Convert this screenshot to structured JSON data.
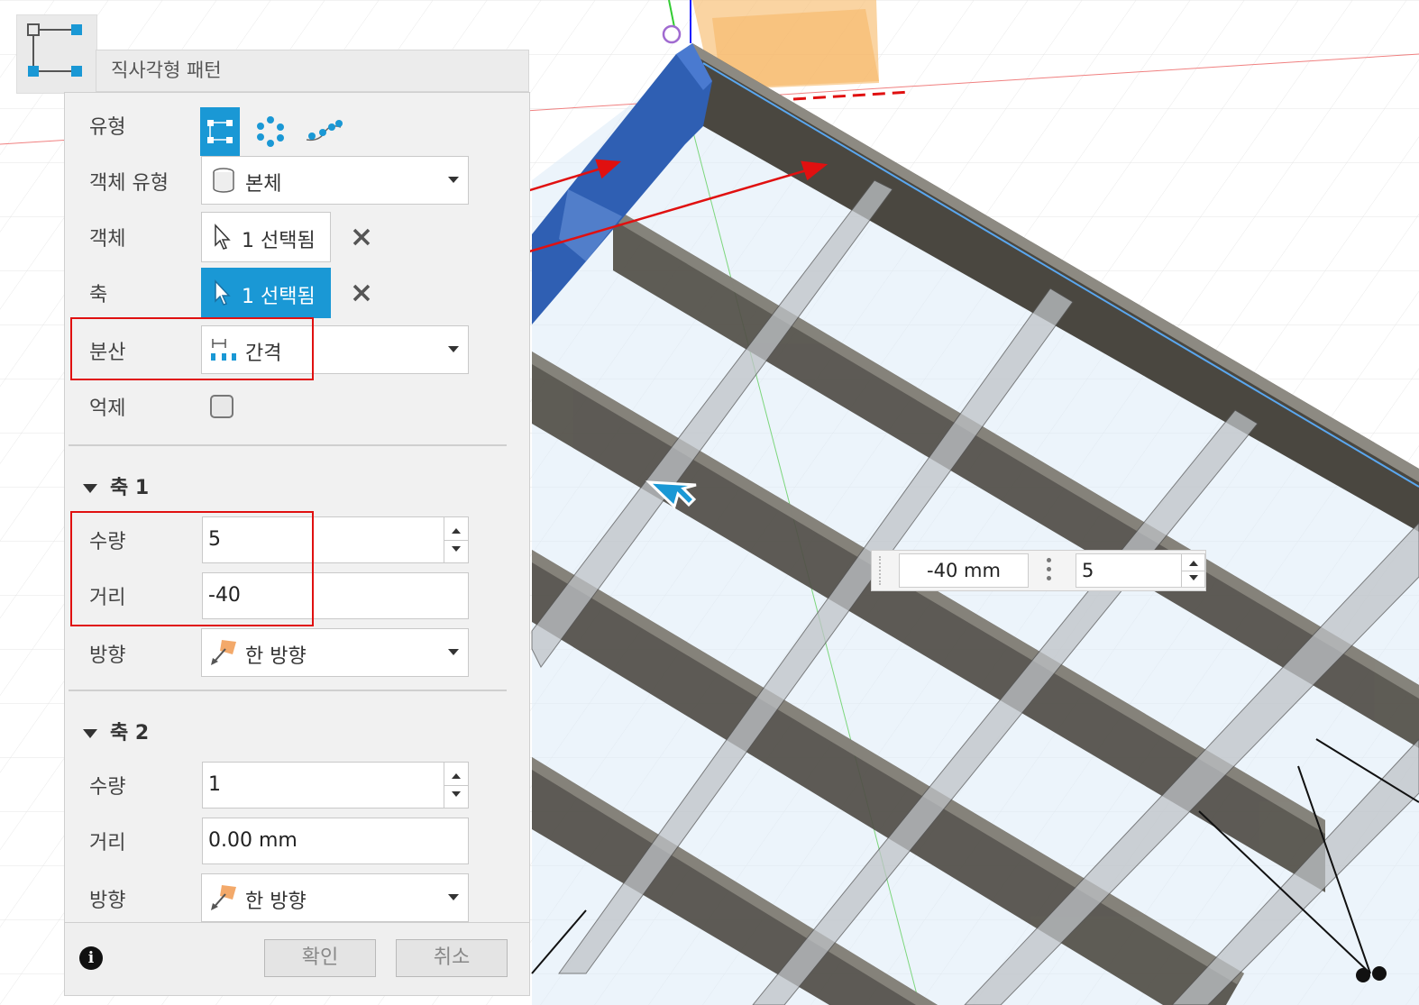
{
  "dialog": {
    "title": "직사각형 패턴",
    "rows": {
      "type_label": "유형",
      "object_type_label": "객체 유형",
      "object_type_value": "본체",
      "objects_label": "객체",
      "objects_value": "1 선택됨",
      "axis_label": "축",
      "axis_value": "1 선택됨",
      "distribution_label": "분산",
      "distribution_value": "간격",
      "suppress_label": "억제"
    },
    "axis1": {
      "header": "축 1",
      "quantity_label": "수량",
      "quantity_value": "5",
      "distance_label": "거리",
      "distance_value": "-40",
      "direction_label": "방향",
      "direction_value": "한 방향"
    },
    "axis2": {
      "header": "축 2",
      "quantity_label": "수량",
      "quantity_value": "1",
      "distance_label": "거리",
      "distance_value": "0.00 mm",
      "direction_label": "방향",
      "direction_value": "한 방향"
    },
    "footer": {
      "ok_label": "확인",
      "cancel_label": "취소"
    }
  },
  "viewport_mini_toolbar": {
    "distance": "-40 mm",
    "quantity": "5"
  },
  "icons": [
    "rectangular-pattern-icon",
    "circular-pattern-icon",
    "path-pattern-icon",
    "body-icon",
    "cursor-icon",
    "close-icon",
    "spacing-icon",
    "direction-icon",
    "info-icon",
    "arrow-manipulator-icon"
  ],
  "colors": {
    "accent": "#1a98d5",
    "highlight": "#e01010",
    "selected_body": "#2f5fb3"
  }
}
